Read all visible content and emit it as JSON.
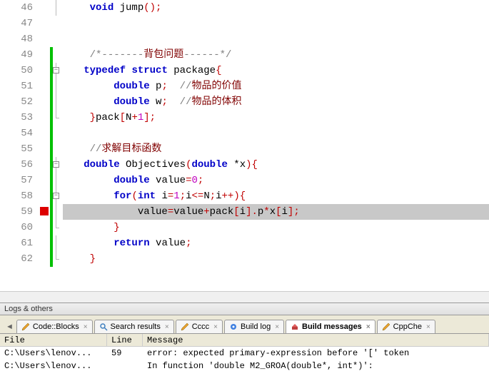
{
  "code": {
    "lines": [
      {
        "num": 46,
        "mark": "",
        "fold": "line",
        "change": "",
        "text": "    void jump();",
        "tokens": [
          [
            "    ",
            "id"
          ],
          [
            "void",
            "kw"
          ],
          [
            " ",
            "id"
          ],
          [
            "jump",
            "fn"
          ],
          [
            "();",
            "op"
          ]
        ]
      },
      {
        "num": 47,
        "mark": "",
        "fold": "",
        "change": "",
        "text": "",
        "tokens": []
      },
      {
        "num": 48,
        "mark": "",
        "fold": "",
        "change": "",
        "text": "",
        "tokens": []
      },
      {
        "num": 49,
        "mark": "",
        "fold": "",
        "change": "green",
        "text": "    /*-------背包问题------*/",
        "tokens": [
          [
            "    ",
            "id"
          ],
          [
            "/*-------",
            "cmt"
          ],
          [
            "背包问题",
            "cmt-cn"
          ],
          [
            "------*/",
            "cmt"
          ]
        ]
      },
      {
        "num": 50,
        "mark": "",
        "fold": "box",
        "change": "green",
        "text": "   typedef struct package{",
        "tokens": [
          [
            "   ",
            "id"
          ],
          [
            "typedef",
            "kw"
          ],
          [
            " ",
            "id"
          ],
          [
            "struct",
            "kw"
          ],
          [
            " ",
            "id"
          ],
          [
            "package",
            "fn"
          ],
          [
            "{",
            "op"
          ]
        ]
      },
      {
        "num": 51,
        "mark": "",
        "fold": "line",
        "change": "green",
        "text": "        double p;  //物品的价值",
        "tokens": [
          [
            "        ",
            "id"
          ],
          [
            "double",
            "kw"
          ],
          [
            " p",
            ""
          ],
          [
            ";",
            "op"
          ],
          [
            "  ",
            "id"
          ],
          [
            "//",
            "cmt"
          ],
          [
            "物品的价值",
            "cmt-cn"
          ]
        ]
      },
      {
        "num": 52,
        "mark": "",
        "fold": "line",
        "change": "green",
        "text": "        double w;  //物品的体积",
        "tokens": [
          [
            "        ",
            "id"
          ],
          [
            "double",
            "kw"
          ],
          [
            " w",
            ""
          ],
          [
            ";",
            "op"
          ],
          [
            "  ",
            "id"
          ],
          [
            "//",
            "cmt"
          ],
          [
            "物品的体积",
            "cmt-cn"
          ]
        ]
      },
      {
        "num": 53,
        "mark": "",
        "fold": "end",
        "change": "green",
        "text": "    }pack[N+1];",
        "tokens": [
          [
            "    ",
            "id"
          ],
          [
            "}",
            "op"
          ],
          [
            "pack",
            "fn"
          ],
          [
            "[",
            "op"
          ],
          [
            "N",
            "id"
          ],
          [
            "+",
            "op"
          ],
          [
            "1",
            "num"
          ],
          [
            "];",
            "op"
          ]
        ]
      },
      {
        "num": 54,
        "mark": "",
        "fold": "",
        "change": "green",
        "text": "",
        "tokens": []
      },
      {
        "num": 55,
        "mark": "",
        "fold": "",
        "change": "green",
        "text": "    //求解目标函数",
        "tokens": [
          [
            "    ",
            "id"
          ],
          [
            "//",
            "cmt"
          ],
          [
            "求解目标函数",
            "cmt-cn"
          ]
        ]
      },
      {
        "num": 56,
        "mark": "",
        "fold": "box",
        "change": "green",
        "text": "   double Objectives(double *x){",
        "tokens": [
          [
            "   ",
            "id"
          ],
          [
            "double",
            "kw"
          ],
          [
            " ",
            "id"
          ],
          [
            "Objectives",
            "fn"
          ],
          [
            "(",
            "op"
          ],
          [
            "double",
            "kw"
          ],
          [
            " *x",
            ""
          ],
          [
            "){",
            "op"
          ]
        ]
      },
      {
        "num": 57,
        "mark": "",
        "fold": "line",
        "change": "green",
        "text": "        double value=0;",
        "tokens": [
          [
            "        ",
            "id"
          ],
          [
            "double",
            "kw"
          ],
          [
            " value",
            ""
          ],
          [
            "=",
            "op"
          ],
          [
            "0",
            "num"
          ],
          [
            ";",
            "op"
          ]
        ]
      },
      {
        "num": 58,
        "mark": "",
        "fold": "box",
        "change": "green",
        "text": "        for(int i=1;i<=N;i++){",
        "tokens": [
          [
            "        ",
            "id"
          ],
          [
            "for",
            "kw"
          ],
          [
            "(",
            "op"
          ],
          [
            "int",
            "kw"
          ],
          [
            " i",
            ""
          ],
          [
            "=",
            "op"
          ],
          [
            "1",
            "num"
          ],
          [
            ";",
            "op"
          ],
          [
            "i",
            ""
          ],
          [
            "<=",
            "op"
          ],
          [
            "N",
            "id"
          ],
          [
            ";",
            "op"
          ],
          [
            "i",
            ""
          ],
          [
            "++){",
            "op"
          ]
        ]
      },
      {
        "num": 59,
        "mark": "err",
        "fold": "line",
        "change": "green",
        "highlight": true,
        "text": "            value=value+pack[i].p*x[i];",
        "tokens": [
          [
            "            value",
            "id"
          ],
          [
            "=",
            "op"
          ],
          [
            "value",
            "id"
          ],
          [
            "+",
            "op"
          ],
          [
            "pack",
            "id"
          ],
          [
            "[",
            "op"
          ],
          [
            "i",
            "id"
          ],
          [
            "].",
            "op"
          ],
          [
            "p",
            "id"
          ],
          [
            "*",
            "op"
          ],
          [
            "x",
            "id"
          ],
          [
            "[",
            "op"
          ],
          [
            "i",
            "id"
          ],
          [
            "];",
            "op"
          ]
        ]
      },
      {
        "num": 60,
        "mark": "",
        "fold": "end",
        "change": "green",
        "text": "        }",
        "tokens": [
          [
            "        ",
            "id"
          ],
          [
            "}",
            "op"
          ]
        ]
      },
      {
        "num": 61,
        "mark": "",
        "fold": "line",
        "change": "green",
        "text": "        return value;",
        "tokens": [
          [
            "        ",
            "id"
          ],
          [
            "return",
            "kw"
          ],
          [
            " value",
            ""
          ],
          [
            ";",
            "op"
          ]
        ]
      },
      {
        "num": 62,
        "mark": "",
        "fold": "end",
        "change": "green",
        "text": "    }",
        "tokens": [
          [
            "    ",
            "id"
          ],
          [
            "}",
            "op"
          ]
        ]
      }
    ]
  },
  "panel": {
    "title": "Logs & others"
  },
  "tabs": [
    {
      "label": "Code::Blocks",
      "icon": "pencil",
      "active": false
    },
    {
      "label": "Search results",
      "icon": "search",
      "active": false
    },
    {
      "label": "Cccc",
      "icon": "pencil",
      "active": false
    },
    {
      "label": "Build log",
      "icon": "gear",
      "active": false
    },
    {
      "label": "Build messages",
      "icon": "build",
      "active": true
    },
    {
      "label": "CppChe",
      "icon": "pencil",
      "active": false
    }
  ],
  "messages": {
    "headers": {
      "file": "File",
      "line": "Line",
      "message": "Message"
    },
    "rows": [
      {
        "file": "C:\\Users\\lenov...",
        "line": "59",
        "message": "error: expected primary-expression before '[' token"
      },
      {
        "file": "C:\\Users\\lenov...",
        "line": "",
        "message": "In function 'double M2_GROA(double*, int*)':"
      }
    ]
  }
}
